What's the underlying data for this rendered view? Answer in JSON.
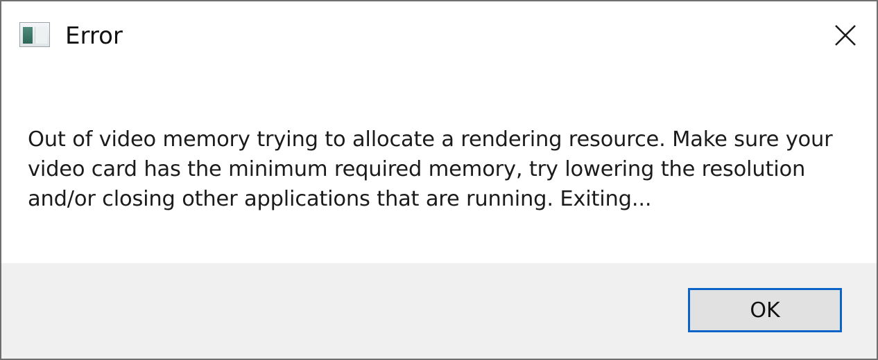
{
  "window": {
    "title": "Error",
    "icon": "application-window-icon",
    "close_icon": "close-icon"
  },
  "message": {
    "text": "Out of video memory trying to allocate a rendering resource. Make sure your video card has the minimum required memory, try lowering the resolution and/or closing other applications that are running. Exiting..."
  },
  "buttons": {
    "ok_label": "OK"
  },
  "colors": {
    "accent_border": "#0a64c8",
    "footer_background": "#f0f0f0",
    "button_background": "#e1e1e1"
  }
}
